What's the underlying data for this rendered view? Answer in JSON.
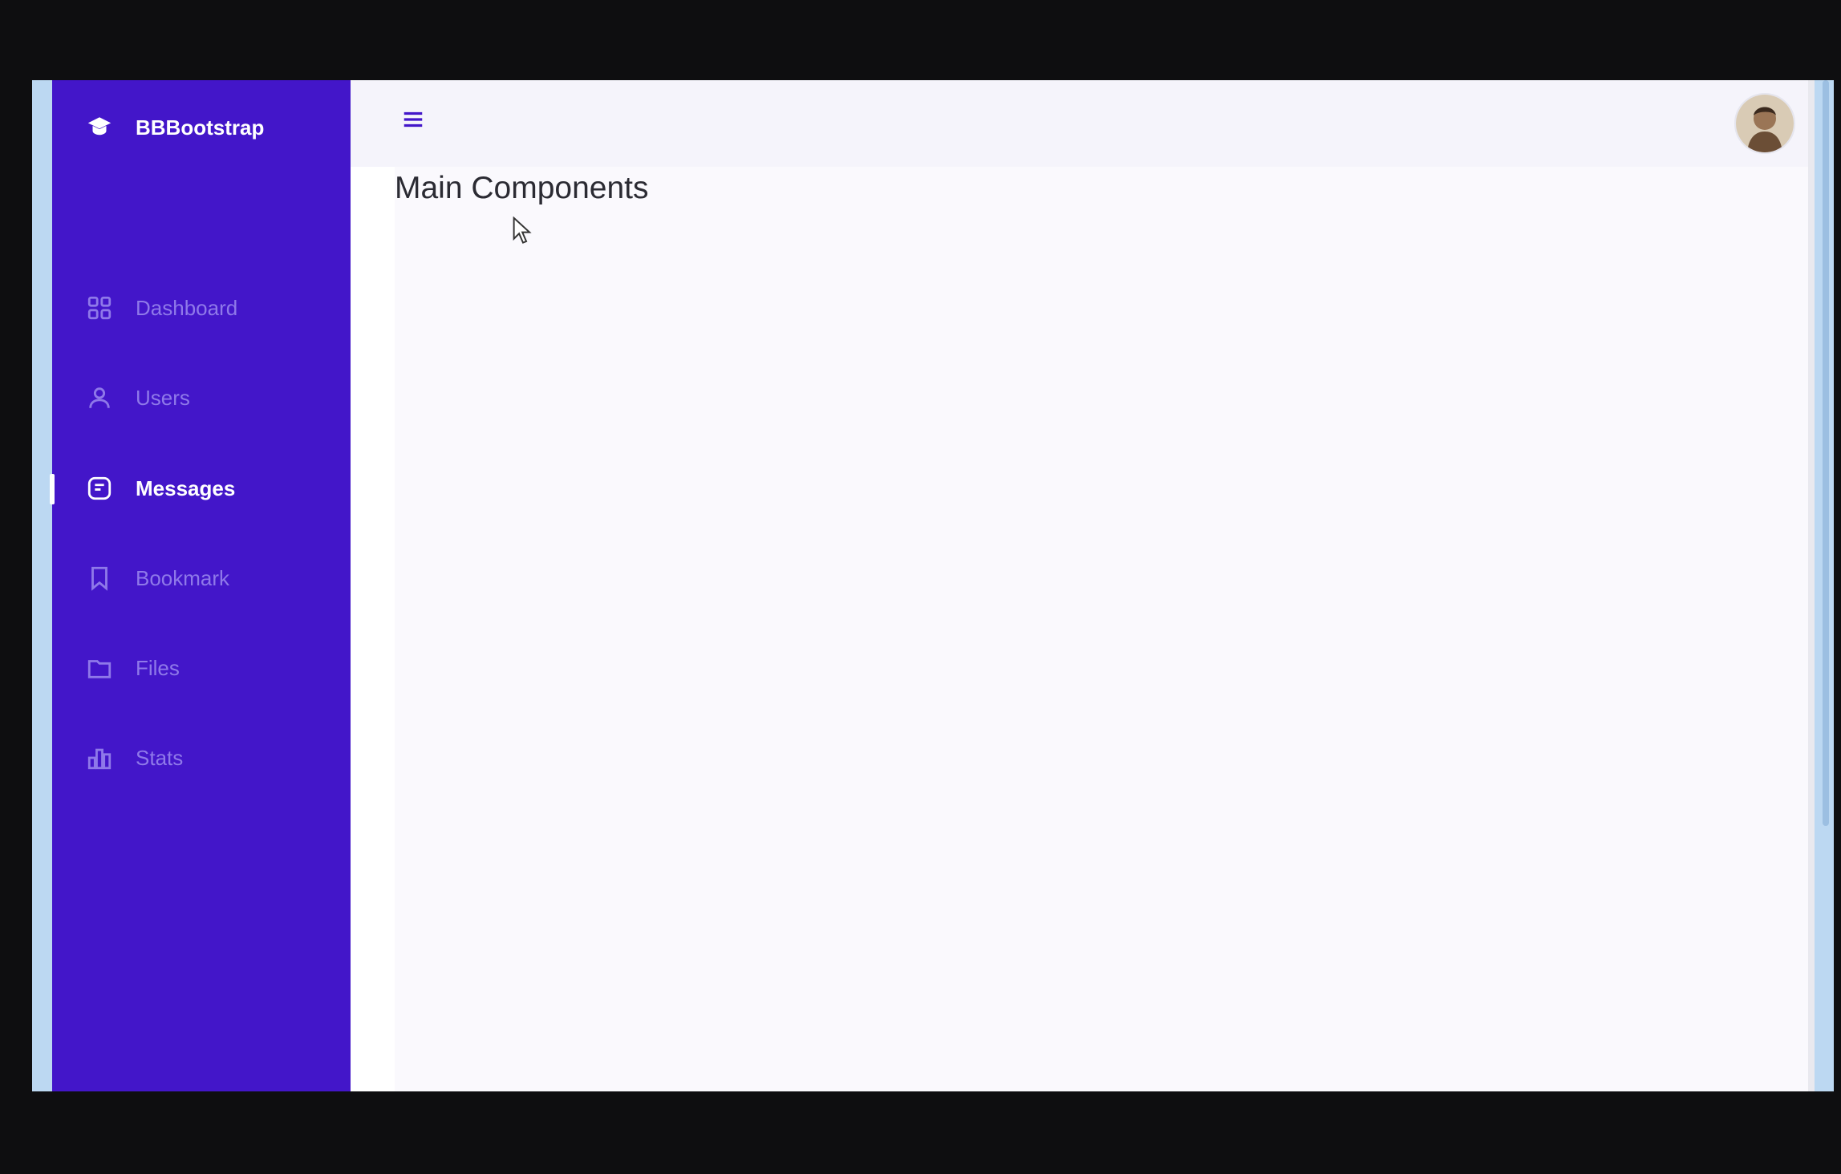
{
  "brand": {
    "name": "BBBootstrap",
    "icon": "graduation-cap-icon"
  },
  "sidebar": {
    "items": [
      {
        "label": "Dashboard",
        "icon": "grid-icon",
        "active": false
      },
      {
        "label": "Users",
        "icon": "user-icon",
        "active": false
      },
      {
        "label": "Messages",
        "icon": "message-icon",
        "active": true
      },
      {
        "label": "Bookmark",
        "icon": "bookmark-icon",
        "active": false
      },
      {
        "label": "Files",
        "icon": "folder-icon",
        "active": false
      },
      {
        "label": "Stats",
        "icon": "bar-chart-icon",
        "active": false
      }
    ]
  },
  "header": {
    "menu_icon": "hamburger-icon",
    "avatar": "user-avatar"
  },
  "main": {
    "title": "Main Components"
  },
  "colors": {
    "sidebar_bg": "#4316c9",
    "sidebar_text": "#8f79e9",
    "active_text": "#ffffff",
    "topbar_bg": "#f5f4fb"
  }
}
